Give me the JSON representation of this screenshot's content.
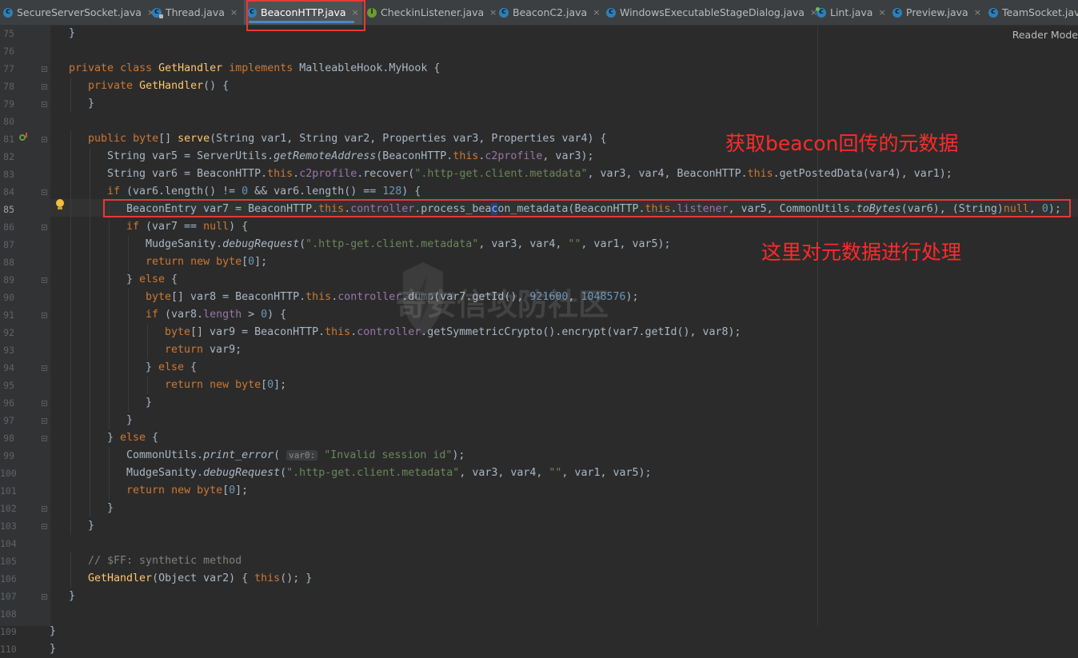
{
  "tabs": [
    {
      "label": "SecureServerSocket.java",
      "icon": "class-icon"
    },
    {
      "label": "Thread.java",
      "icon": "class-lock-icon"
    },
    {
      "label": "BeaconHTTP.java",
      "icon": "class-icon",
      "active": true
    },
    {
      "label": "CheckinListener.java",
      "icon": "interface-icon"
    },
    {
      "label": "BeaconC2.java",
      "icon": "class-icon"
    },
    {
      "label": "WindowsExecutableStageDialog.java",
      "icon": "class-icon"
    },
    {
      "label": "Lint.java",
      "icon": "class-run-icon"
    },
    {
      "label": "Preview.java",
      "icon": "class-icon"
    },
    {
      "label": "TeamSocket.java",
      "icon": "class-icon"
    }
  ],
  "tab_close_glyph": "×",
  "reader_mode": "Reader Mode",
  "editor": {
    "current_line": 85,
    "lines": [
      {
        "n": 75,
        "code": "<span class=\"indent\"></span>}"
      },
      {
        "n": 76,
        "code": ""
      },
      {
        "n": 77,
        "code": "private class GetHandler implements MalleableHook.MyHook {"
      },
      {
        "n": 78,
        "code": "private GetHandler() {"
      },
      {
        "n": 79,
        "code": "}"
      },
      {
        "n": 80,
        "code": ""
      },
      {
        "n": 81,
        "code": "public byte[] serve(String var1, String var2, Properties var3, Properties var4) {"
      },
      {
        "n": 82,
        "code": "String var5 = ServerUtils.getRemoteAddress(BeaconHTTP.this.c2profile, var3);"
      },
      {
        "n": 83,
        "code": "String var6 = BeaconHTTP.this.c2profile.recover(\".http-get.client.metadata\", var3, var4, BeaconHTTP.this.getPostedData(var4), var1);"
      },
      {
        "n": 84,
        "code": "if (var6.length() != 0 && var6.length() == 128) {"
      },
      {
        "n": 85,
        "code": "BeaconEntry var7 = BeaconHTTP.this.controller.process_beacon_metadata(BeaconHTTP.this.listener, var5, CommonUtils.toBytes(var6), (String)null, 0);"
      },
      {
        "n": 86,
        "code": "if (var7 == null) {"
      },
      {
        "n": 87,
        "code": "MudgeSanity.debugRequest(\".http-get.client.metadata\", var3, var4, \"\", var1, var5);"
      },
      {
        "n": 88,
        "code": "return new byte[0];"
      },
      {
        "n": 89,
        "code": "} else {"
      },
      {
        "n": 90,
        "code": "byte[] var8 = BeaconHTTP.this.controller.dump(var7.getId(), 921600, 1048576);"
      },
      {
        "n": 91,
        "code": "if (var8.length > 0) {"
      },
      {
        "n": 92,
        "code": "byte[] var9 = BeaconHTTP.this.controller.getSymmetricCrypto().encrypt(var7.getId(), var8);"
      },
      {
        "n": 93,
        "code": "return var9;"
      },
      {
        "n": 94,
        "code": "} else {"
      },
      {
        "n": 95,
        "code": "return new byte[0];"
      },
      {
        "n": 96,
        "code": "}"
      },
      {
        "n": 97,
        "code": "}"
      },
      {
        "n": 98,
        "code": "} else {"
      },
      {
        "n": 99,
        "code": "CommonUtils.print_error( var0: \"Invalid session id\");"
      },
      {
        "n": 100,
        "code": "MudgeSanity.debugRequest(\".http-get.client.metadata\", var3, var4, \"\", var1, var5);"
      },
      {
        "n": 101,
        "code": "return new byte[0];"
      },
      {
        "n": 102,
        "code": "}"
      },
      {
        "n": 103,
        "code": "}"
      },
      {
        "n": 104,
        "code": ""
      },
      {
        "n": 105,
        "code": "// $FF: synthetic method"
      },
      {
        "n": 106,
        "code": "GetHandler(Object var2) { this(); }"
      },
      {
        "n": 107,
        "code": "}"
      },
      {
        "n": 108,
        "code": ""
      },
      {
        "n": 109,
        "code": "}"
      },
      {
        "n": 110,
        "code": "}"
      }
    ]
  },
  "annotations": {
    "top": "获取beacon回传的元数据",
    "bottom": "这里对元数据进行处理"
  },
  "watermark": "奇安信攻防社区",
  "colors": {
    "annotation": "#ff2a2a",
    "keyword": "#cc7832",
    "string": "#6a8759",
    "number": "#6897bb",
    "field": "#9876aa",
    "method": "#ffc66d",
    "text": "#a9b7c6"
  }
}
